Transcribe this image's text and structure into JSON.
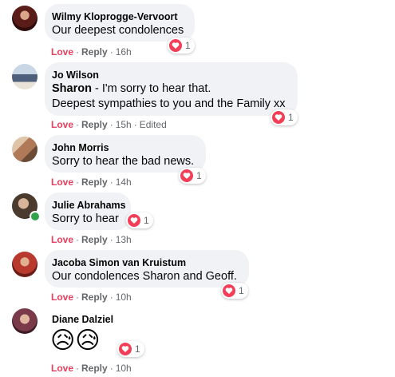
{
  "comments": [
    {
      "author": "Wilmy Kloprogge-Vervoort",
      "lines": [
        "Our deepest condolences"
      ],
      "love": "Love",
      "reply": "Reply",
      "time": "16h",
      "reaction_count": "1",
      "avatar_color": "#7a2e24"
    },
    {
      "author": "Jo Wilson",
      "mention": "Sharon",
      "lines": [
        " - I'm sorry to hear that.",
        "Deepest sympathies to you and the Family xx"
      ],
      "love": "Love",
      "reply": "Reply",
      "time": "15h",
      "edited": "Edited",
      "reaction_count": "1",
      "avatar_color": "#6f86a6"
    },
    {
      "author": "John Morris",
      "lines": [
        "Sorry to hear the bad news."
      ],
      "love": "Love",
      "reply": "Reply",
      "time": "14h",
      "reaction_count": "1",
      "avatar_color": "#b88a6a"
    },
    {
      "author": "Julie Abrahams",
      "lines": [
        "Sorry to hear"
      ],
      "love": "Love",
      "reply": "Reply",
      "time": "13h",
      "reaction_count": "1",
      "avatar_color": "#5a4a3a",
      "online": true
    },
    {
      "author": "Jacoba Simon van Kruistum",
      "lines": [
        "Our condolences Sharon and Geoff."
      ],
      "love": "Love",
      "reply": "Reply",
      "time": "10h",
      "reaction_count": "1",
      "avatar_color": "#a03030"
    },
    {
      "author": "Diane Dalziel",
      "emoji": "😥😥",
      "love": "Love",
      "reply": "Reply",
      "time": "10h",
      "reaction_count": "1",
      "avatar_color": "#8a5060"
    }
  ],
  "colors": {
    "bubble": "#f0f2f5",
    "love_text": "#e4405f",
    "heart": "#f33e58",
    "meta": "#65676b",
    "online": "#31a24c"
  },
  "icons": {
    "reaction": "heart-icon",
    "status": "online-dot"
  }
}
